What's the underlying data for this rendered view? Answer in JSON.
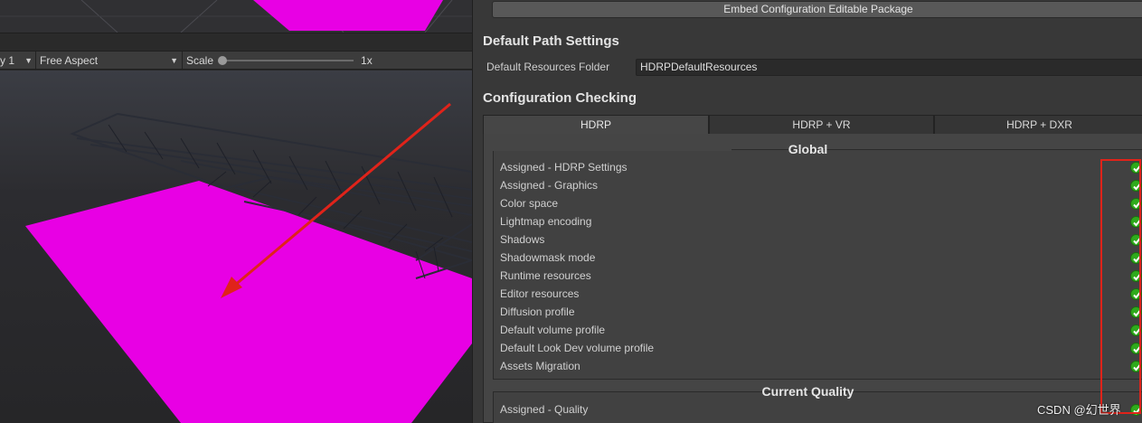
{
  "game_view": {
    "display_label": "y 1",
    "aspect_label": "Free Aspect",
    "scale_label": "Scale",
    "scale_value": "1x",
    "scale_slider_fraction": 0.0
  },
  "panel": {
    "embed_button_label": "Embed Configuration Editable Package",
    "default_path_title": "Default Path Settings",
    "resources_folder_label": "Default Resources Folder",
    "resources_folder_value": "HDRPDefaultResources",
    "config_title": "Configuration Checking",
    "tabs": [
      "HDRP",
      "HDRP + VR",
      "HDRP + DXR"
    ],
    "global_title": "Global",
    "global_items": [
      "Assigned - HDRP Settings",
      "Assigned - Graphics",
      "Color space",
      "Lightmap encoding",
      "Shadows",
      "Shadowmask mode",
      "Runtime resources",
      "Editor resources",
      "Diffusion profile",
      "Default volume profile",
      "Default Look Dev volume profile",
      "Assets Migration"
    ],
    "quality_title": "Current Quality",
    "quality_items": [
      "Assigned - Quality"
    ],
    "watermark": "CSDN @幻世界"
  },
  "colors": {
    "magenta": "#e800e4",
    "check_green": "#2faa1c",
    "annotation_red": "#e0231a"
  },
  "icons": [
    "chevron-down-icon",
    "checkmark-icon"
  ]
}
